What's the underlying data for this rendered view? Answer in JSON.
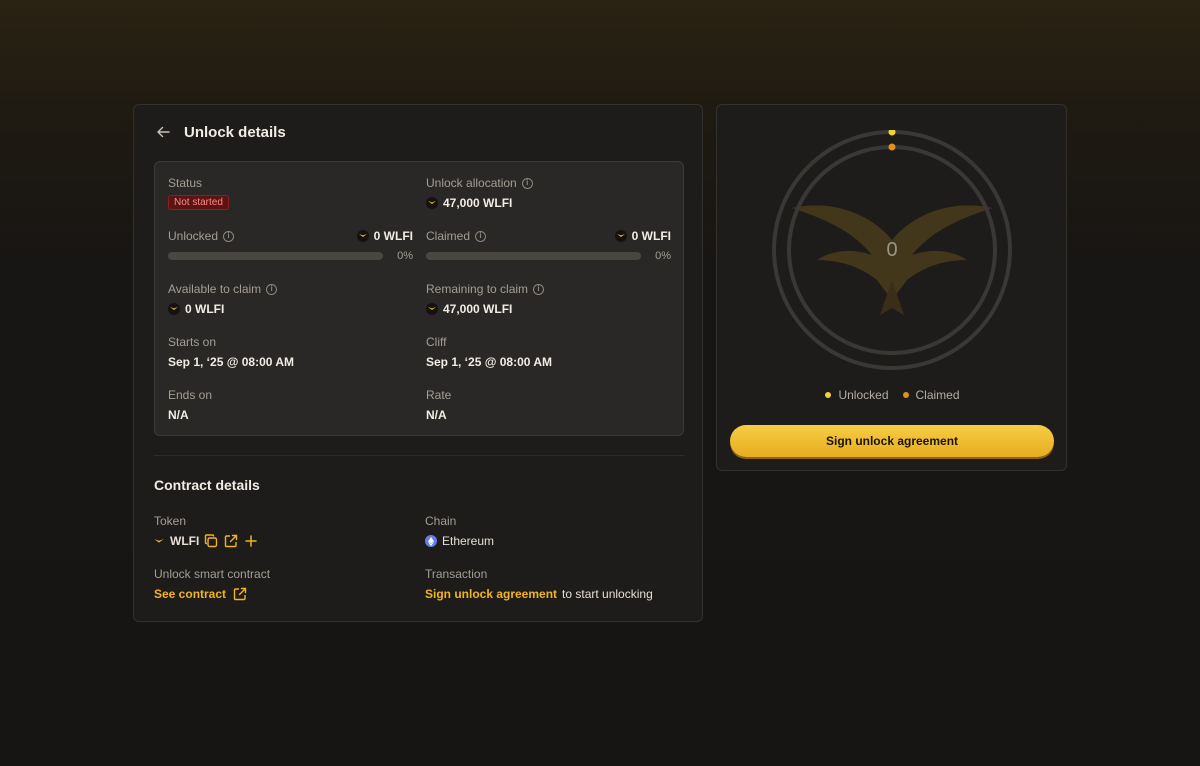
{
  "header": {
    "title": "Unlock details"
  },
  "details": {
    "status_label": "Status",
    "status_value": "Not started",
    "allocation_label": "Unlock allocation",
    "allocation_value": "47,000 WLFI",
    "unlocked_label": "Unlocked",
    "unlocked_amount": "0 WLFI",
    "unlocked_percent": "0%",
    "unlocked_fraction": 0,
    "claimed_label": "Claimed",
    "claimed_amount": "0 WLFI",
    "claimed_percent": "0%",
    "claimed_fraction": 0,
    "available_label": "Available to claim",
    "available_value": "0 WLFI",
    "remaining_label": "Remaining to claim",
    "remaining_value": "47,000 WLFI",
    "starts_label": "Starts on",
    "starts_value": "Sep 1, ‘25 @ 08:00 AM",
    "cliff_label": "Cliff",
    "cliff_value": "Sep 1, ‘25 @ 08:00 AM",
    "ends_label": "Ends on",
    "ends_value": "N/A",
    "rate_label": "Rate",
    "rate_value": "N/A"
  },
  "contract": {
    "title": "Contract details",
    "token_label": "Token",
    "token_value": "WLFI",
    "chain_label": "Chain",
    "chain_value": "Ethereum",
    "smart_contract_label": "Unlock smart contract",
    "see_contract_link": "See contract",
    "transaction_label": "Transaction",
    "transaction_link": "Sign unlock agreement",
    "transaction_suffix": "to start unlocking"
  },
  "summary": {
    "center_value": "0",
    "legend_unlocked": "Unlocked",
    "legend_claimed": "Claimed",
    "cta_label": "Sign unlock agreement"
  },
  "colors": {
    "accent": "#f2b41e",
    "unlocked_dot": "#f5cf3a",
    "claimed_dot": "#e0901c",
    "badge_bg": "#5a1414"
  },
  "icons": {
    "back": "arrow-left-icon",
    "info": "info-icon",
    "token": "wlfi-eagle-icon",
    "copy": "copy-icon",
    "external": "external-link-icon",
    "add": "plus-icon",
    "chain": "ethereum-icon"
  }
}
